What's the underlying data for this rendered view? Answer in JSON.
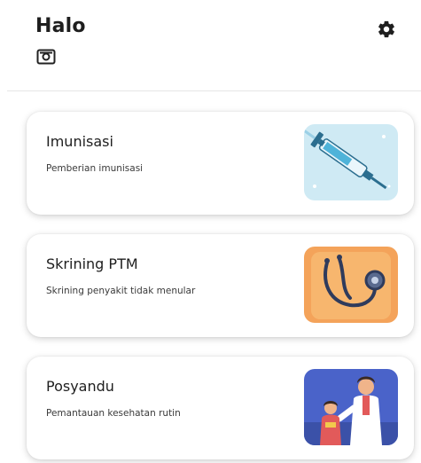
{
  "header": {
    "greeting": "Halo",
    "id_icon": "id-card-icon",
    "settings_icon": "gear-icon"
  },
  "cards": [
    {
      "title": "Imunisasi",
      "subtitle": "Pemberian imunisasi",
      "illustration": "syringe-illustration",
      "bg": "#cfeaf4"
    },
    {
      "title": "Skrining PTM",
      "subtitle": "Skrining penyakit tidak menular",
      "illustration": "stethoscope-illustration",
      "bg": "#f4a35a"
    },
    {
      "title": "Posyandu",
      "subtitle": "Pemantauan kesehatan rutin",
      "illustration": "doctor-child-illustration",
      "bg": "#4a63c9"
    }
  ]
}
